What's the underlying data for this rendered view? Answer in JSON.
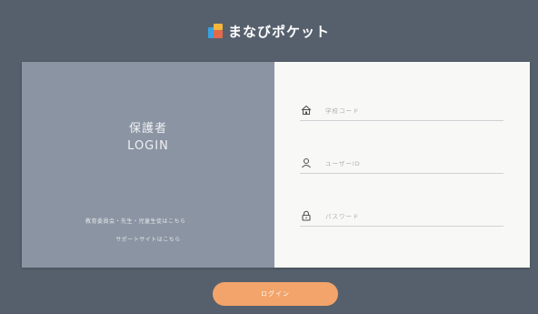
{
  "app": {
    "name": "まなびポケット"
  },
  "panel": {
    "role_title": "保護者",
    "role_subtitle": "LOGIN",
    "teacher_link": "教育委員会・先生・児童生徒はこちら",
    "support_link": "サポートサイトはこちら"
  },
  "form": {
    "school_code_placeholder": "学校コード",
    "user_id_placeholder": "ユーザーID",
    "password_placeholder": "パスワード",
    "login_label": "ログイン"
  },
  "colors": {
    "background": "#56606d",
    "left_panel": "#8b94a2",
    "right_panel": "#f8f8f6",
    "accent": "#f2a46a"
  },
  "icons": {
    "school": "school-icon",
    "user": "user-icon",
    "lock": "lock-icon"
  }
}
